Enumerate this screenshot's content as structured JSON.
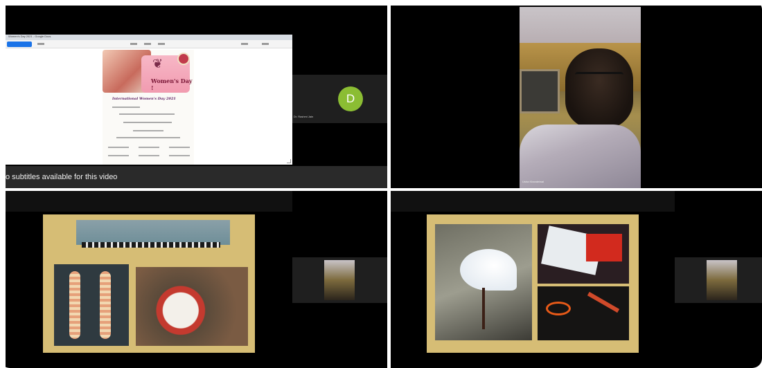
{
  "app": {
    "subtitle_notice": "o subtitles available for this video"
  },
  "shared_screen": {
    "window_title": "Women's Day 2021 - Google Docs",
    "poster_heading": "Women's Day !",
    "poster_title": "International Women's Day 2021"
  },
  "participants": {
    "tile1_avatar_letter": "D",
    "tile1_name": "Dr. Rashmi Jain",
    "tile2_name": "Usha Khandelwal"
  },
  "colors": {
    "avatar": "#8bbd33",
    "slide_background": "#d6bd75"
  }
}
